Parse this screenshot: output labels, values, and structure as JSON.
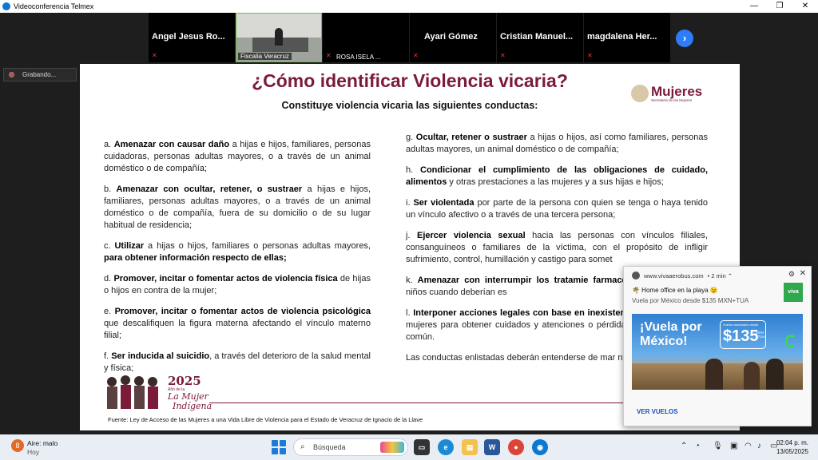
{
  "window": {
    "title": "Videoconferencia Telmex",
    "controls": {
      "minimize": "—",
      "maximize": "❐",
      "close": "✕"
    }
  },
  "participants": [
    {
      "name": "Angel Jesus Ro..."
    },
    {
      "name": "",
      "caption": "Fiscalia Veracruz"
    },
    {
      "name": "",
      "caption": "ROSA ISELA ..."
    },
    {
      "name": "Ayari Gómez"
    },
    {
      "name": "Cristian Manuel..."
    },
    {
      "name": "magdalena Her..."
    }
  ],
  "recording": {
    "label": "Grabando..."
  },
  "slide": {
    "title": "¿Cómo identificar Violencia vicaria?",
    "subtitle": "Constituye violencia vicaria las siguientes conductas:",
    "logo": {
      "text": "Mujeres",
      "sub": "Secretaría de las Mujeres"
    },
    "left_items": [
      {
        "pre": "a. ",
        "bold": "Amenazar con causar daño",
        "rest": " a hijas e hijos, familiares, personas cuidadoras, personas adultas mayores, o a través de un animal doméstico o de compañía;"
      },
      {
        "pre": "b. ",
        "bold": "Amenazar con ocultar, retener, o sustraer",
        "rest": " a hijas e hijos, familiares, personas adultas mayores, o a través de un animal doméstico o de compañía, fuera de su domicilio o de su lugar habitual de residencia;"
      },
      {
        "pre": "c. ",
        "bold": "Utilizar",
        "rest": " a hijas o hijos, familiares o personas adultas mayores, ",
        "bold2": "para obtener información respecto de ellas;"
      },
      {
        "pre": "d. ",
        "bold": "Promover, incitar o fomentar actos de violencia física",
        "rest": " de hijas o hijos en contra de la mujer;"
      },
      {
        "pre": "e. ",
        "bold": "Promover, incitar o fomentar actos de violencia psicológica",
        "rest": " que descalifiquen la figura materna afectando el vínculo materno filial;"
      },
      {
        "pre": "f. ",
        "bold": "Ser inducida al suicidio",
        "rest": ", a través del deterioro de la salud mental y física;"
      }
    ],
    "right_items": [
      {
        "pre": "g. ",
        "bold": "Ocultar, retener o sustraer",
        "rest": " a hijas o hijos, así como familiares, personas adultas mayores, un animal doméstico o de compañía;"
      },
      {
        "pre": "h. ",
        "bold": "Condicionar el cumplimiento de las obligaciones de cuidado, alimentos",
        "rest": " y otras prestaciones a las mujeres y a sus hijas e hijos;"
      },
      {
        "pre": "i. ",
        "bold": "Ser violentada",
        "rest": " por parte de la persona con quien se tenga o haya tenido un vínculo afectivo o a través de una tercera persona;"
      },
      {
        "pre": "j. ",
        "bold": "Ejercer violencia sexual",
        "rest": " hacia las personas con vínculos filiales, consanguíneos o familiares de la víctima, con el propósito de infligir sufrimiento, control, humillación y castigo para somet"
      },
      {
        "pre": "k. ",
        "bold": "Amenazar con interrumpir los tratamie farmacológicos",
        "rest": " de niñas y niños cuando deberían es"
      },
      {
        "pre": "l. ",
        "bold": "Interponer acciones legales con base en inexistentes",
        "rest": ", en contra de las mujeres para obtener cuidados y atenciones o pérdida de la patria potesta común."
      }
    ],
    "closing": "Las conductas enlistadas deberán entenderse de mar no limitativa.",
    "year_logo": {
      "year": "2025",
      "line2": "Año de la",
      "line3": "La Mujer",
      "line4": "Indígena"
    },
    "source": "Fuente: Ley de Acceso de las Mujeres a una Vida Libre de Violencia para el Estado de Veracruz de Ignacio de la Llave"
  },
  "notification": {
    "site": "www.vivaaerobus.com",
    "time": "• 2 min ⌃",
    "title": "🌴 Home office en la playa 😉",
    "body": "Vuela por México desde $135 MXN+TUA",
    "brand": "viva",
    "ad_headline": "¡Vuela por México!",
    "ad_price_label": "Vuelos nacionales desde",
    "ad_price": "$135",
    "ad_price_unit": "MXN +TUA",
    "cta": "VER VUELOS"
  },
  "taskbar": {
    "weather_title": "Aire: malo",
    "weather_sub": "Hoy",
    "weather_badge": "8",
    "search_placeholder": "Búsqueda",
    "time": "02:04 p. m.",
    "date": "13/05/2025"
  }
}
